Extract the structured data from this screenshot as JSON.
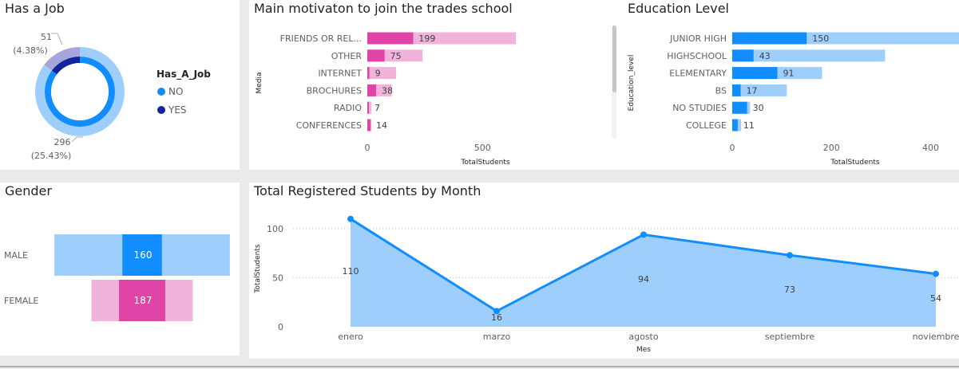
{
  "colors": {
    "no": "#118DFF",
    "yes": "#12239E",
    "light_blue": "#9ECFFC",
    "pink": "#E044A7",
    "light_pink": "#F0B3DA",
    "donut_light_blue": "#9ECFFC",
    "donut_light_purple": "#A6A6DA"
  },
  "has_job": {
    "title": "Has a Job",
    "legend_title": "Has_A_Job",
    "legend": [
      "NO",
      "YES"
    ],
    "label_yes_value": "51",
    "label_yes_pct": "(4.38%)",
    "label_no_value": "296",
    "label_no_pct": "(25.43%)"
  },
  "motivation": {
    "title": "Main motivaton to join the trades school",
    "ylabel": "Media",
    "xlabel": "TotalStudents",
    "ticks": [
      "0",
      "500"
    ]
  },
  "education": {
    "title": "Education Level",
    "ylabel": "Education_level",
    "xlabel": "TotalStudents",
    "ticks": [
      "0",
      "200",
      "400"
    ]
  },
  "gender": {
    "title": "Gender"
  },
  "monthly": {
    "title": "Total Registered Students by Month",
    "ylabel": "TotalStudents",
    "xlabel": "Mes",
    "yticks": [
      "100",
      "50",
      "0"
    ]
  },
  "chart_data": [
    {
      "type": "pie",
      "title": "Has a Job",
      "categories": [
        "NO",
        "YES"
      ],
      "outer_ring": {
        "values": [
          296,
          51
        ],
        "labels": [
          "296 (25.43%)",
          "51 (4.38%)"
        ]
      },
      "inner_ring": {
        "values": [
          296,
          51
        ]
      },
      "legend_position": "right"
    },
    {
      "type": "bar",
      "orientation": "horizontal",
      "title": "Main motivaton to join the trades school",
      "categories": [
        "FRIENDS OR REL...",
        "OTHER",
        "INTERNET",
        "BROCHURES",
        "RADIO",
        "CONFERENCES"
      ],
      "series": [
        {
          "values": [
            199,
            75,
            9,
            38,
            7,
            14
          ]
        },
        {
          "values": [
            645,
            240,
            125,
            105,
            18,
            18
          ]
        }
      ],
      "data_labels": [
        "199",
        "75",
        "9",
        "38",
        "7",
        "14"
      ],
      "xlabel": "TotalStudents",
      "ylabel": "Media",
      "xlim": [
        0,
        650
      ]
    },
    {
      "type": "bar",
      "orientation": "horizontal",
      "title": "Education Level",
      "categories": [
        "JUNIOR HIGH",
        "HIGHSCHOOL",
        "ELEMENTARY",
        "BS",
        "NO STUDIES",
        "COLLEGE"
      ],
      "series": [
        {
          "values": [
            150,
            43,
            91,
            17,
            30,
            11
          ]
        },
        {
          "values": [
            460,
            308,
            181,
            110,
            36,
            18
          ]
        }
      ],
      "data_labels": [
        "150",
        "43",
        "91",
        "17",
        "30",
        "11"
      ],
      "xlabel": "TotalStudents",
      "ylabel": "Education_level",
      "xlim": [
        0,
        455
      ]
    },
    {
      "type": "bar",
      "orientation": "horizontal",
      "title": "Gender",
      "categories": [
        "MALE",
        "FEMALE"
      ],
      "series": [
        {
          "values": [
            160,
            187
          ]
        },
        {
          "values": [
            710,
            410
          ]
        }
      ],
      "data_labels": [
        "160",
        "187"
      ]
    },
    {
      "type": "area",
      "title": "Total Registered Students by Month",
      "categories": [
        "enero",
        "marzo",
        "agosto",
        "septiembre",
        "noviembre"
      ],
      "values": [
        110,
        16,
        94,
        73,
        54
      ],
      "data_labels": [
        "110",
        "16",
        "94",
        "73",
        "54"
      ],
      "xlabel": "Mes",
      "ylabel": "TotalStudents",
      "ylim": [
        0,
        100
      ],
      "grid": true
    }
  ]
}
